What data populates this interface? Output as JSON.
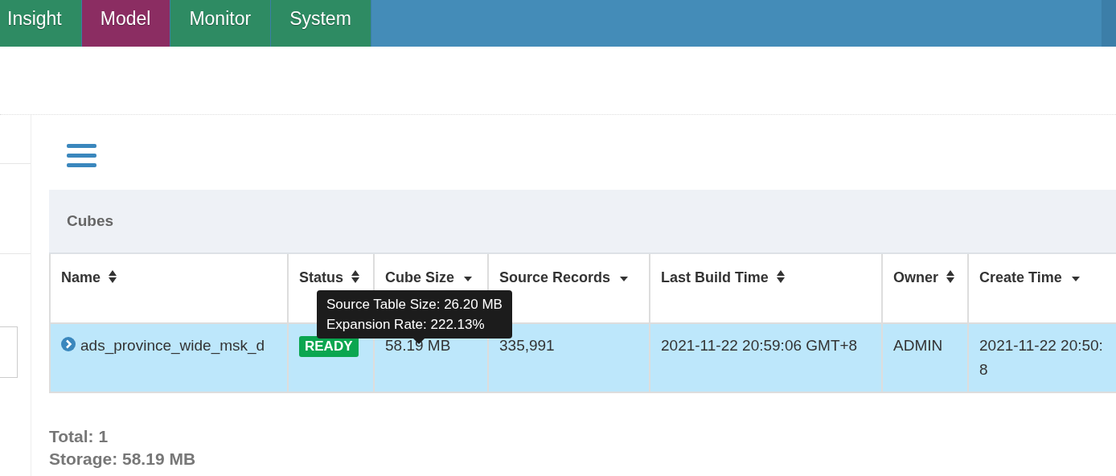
{
  "nav": {
    "tabs": [
      {
        "label": "Insight",
        "selected": false
      },
      {
        "label": "Model",
        "selected": true
      },
      {
        "label": "Monitor",
        "selected": false
      },
      {
        "label": "System",
        "selected": false
      }
    ]
  },
  "panel": {
    "title": "Cubes"
  },
  "table": {
    "columns": [
      {
        "label": "Name",
        "kind": "sortable"
      },
      {
        "label": "Status",
        "kind": "sortable"
      },
      {
        "label": "Cube Size",
        "kind": "sorted"
      },
      {
        "label": "Source Records",
        "kind": "sorted"
      },
      {
        "label": "Last Build Time",
        "kind": "sortable"
      },
      {
        "label": "Owner",
        "kind": "sortable"
      },
      {
        "label": "Create Time",
        "kind": "sorted"
      }
    ],
    "rows": [
      {
        "selected": true,
        "cells": [
          {
            "kind": "name",
            "text": "ads_province_wide_msk_d"
          },
          {
            "kind": "status",
            "text": "READY"
          },
          {
            "kind": "text",
            "text": "58.19 MB"
          },
          {
            "kind": "text",
            "text": "335,991"
          },
          {
            "kind": "text",
            "text": "2021-11-22 20:59:06 GMT+8"
          },
          {
            "kind": "text",
            "text": "ADMIN"
          },
          {
            "kind": "text",
            "text": "2021-11-22 20:50:\n8"
          }
        ]
      }
    ]
  },
  "tooltip": {
    "lines": [
      "Source Table Size: 26.20 MB",
      "Expansion Rate: 222.13%"
    ]
  },
  "summary": [
    "Total: 1",
    "Storage: 58.19 MB"
  ]
}
